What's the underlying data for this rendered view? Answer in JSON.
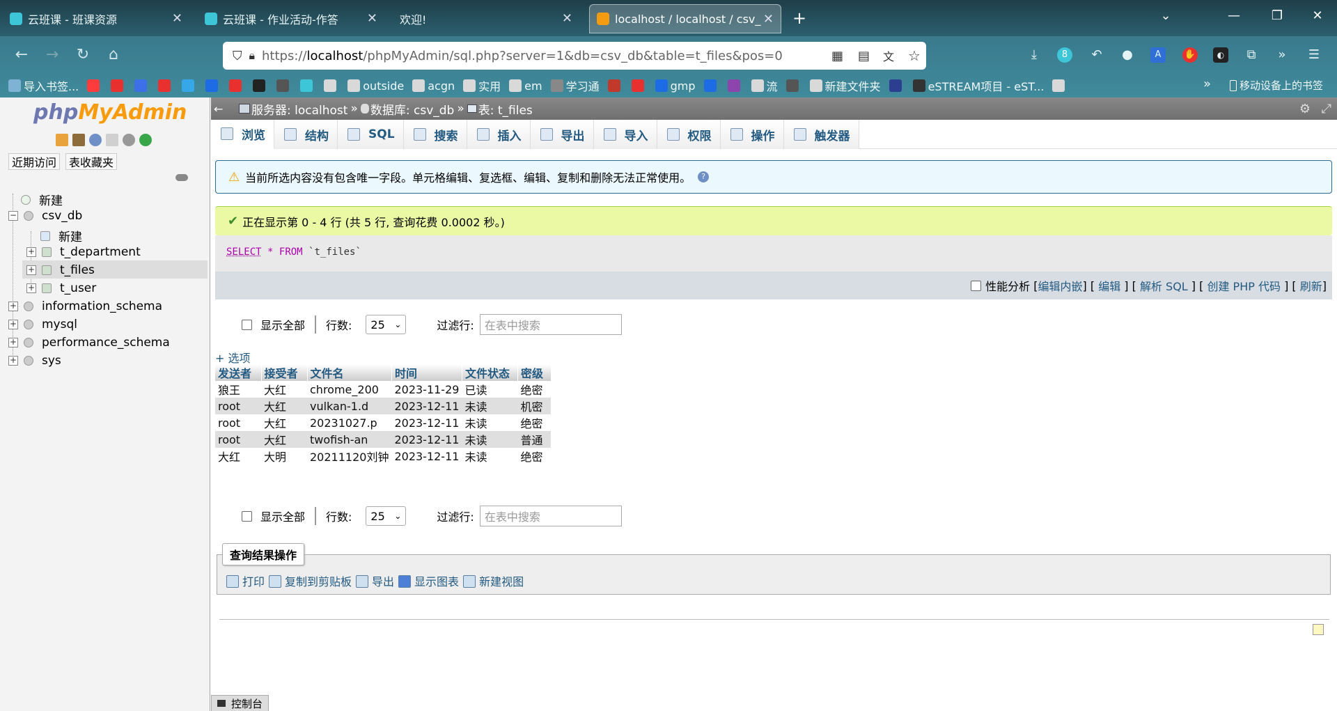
{
  "browser": {
    "tabs": [
      {
        "label": "云班课 - 班课资源"
      },
      {
        "label": "云班课 - 作业活动-作答"
      },
      {
        "label": "欢迎!"
      },
      {
        "label": "localhost / localhost / csv_db"
      }
    ],
    "new_tab": "+",
    "url_prefix": "https://",
    "url_host": "localhost",
    "url_path": "/phpMyAdmin/sql.php?server=1&db=csv_db&table=t_files&pos=0",
    "extension_badge": "8",
    "bookmarks": [
      {
        "label": "导入书签...",
        "color": "#7fb3d5"
      },
      {
        "label": "",
        "color": "#ff3b3b"
      },
      {
        "label": "",
        "color": "#e8312f"
      },
      {
        "label": "",
        "color": "#3d6fe8"
      },
      {
        "label": "",
        "color": "#e8312f"
      },
      {
        "label": "",
        "color": "#36a7e8"
      },
      {
        "label": "",
        "color": "#1e6be6"
      },
      {
        "label": "",
        "color": "#e8312f"
      },
      {
        "label": "",
        "color": "#222222"
      },
      {
        "label": "",
        "color": "#555555"
      },
      {
        "label": "",
        "color": "#3cc6d8"
      },
      {
        "label": "",
        "color": "#d9d9d9"
      },
      {
        "label": "outside",
        "color": "#d9d9d9"
      },
      {
        "label": "acgn",
        "color": "#d9d9d9"
      },
      {
        "label": "实用",
        "color": "#d9d9d9"
      },
      {
        "label": "em",
        "color": "#d9d9d9"
      },
      {
        "label": "学习通",
        "color": "#888888"
      },
      {
        "label": "",
        "color": "#c0392b"
      },
      {
        "label": "",
        "color": "#e8312f"
      },
      {
        "label": "gmp",
        "color": "#1e6be6"
      },
      {
        "label": "",
        "color": "#1e6be6"
      },
      {
        "label": "",
        "color": "#8e44ad"
      },
      {
        "label": "流",
        "color": "#d9d9d9"
      },
      {
        "label": "",
        "color": "#555555"
      },
      {
        "label": "新建文件夹",
        "color": "#d9d9d9"
      },
      {
        "label": "",
        "color": "#2c3e8f"
      },
      {
        "label": "eSTREAM项目 - eST...",
        "color": "#333333"
      },
      {
        "label": "",
        "color": "#d9d9d9"
      }
    ],
    "bookmarks_more": "»",
    "mobile_bookmarks": "移动设备上的书签"
  },
  "sidebar": {
    "logo_php": "php",
    "logo_myadmin": "MyAdmin",
    "recent_button": "近期访问",
    "favorites_button": "表收藏夹",
    "tree": [
      {
        "label": "新建",
        "level": 0
      },
      {
        "label": "csv_db",
        "level": 0
      },
      {
        "label": "新建",
        "level": 1
      },
      {
        "label": "t_department",
        "level": 1
      },
      {
        "label": "t_files",
        "level": 1
      },
      {
        "label": "t_user",
        "level": 1
      },
      {
        "label": "information_schema",
        "level": 0
      },
      {
        "label": "mysql",
        "level": 0
      },
      {
        "label": "performance_schema",
        "level": 0
      },
      {
        "label": "sys",
        "level": 0
      }
    ]
  },
  "breadcrumb": {
    "server": "服务器: localhost",
    "sep": "»",
    "database": "数据库: csv_db",
    "table": "表: t_files"
  },
  "main_tabs": [
    "浏览",
    "结构",
    "SQL",
    "搜索",
    "插入",
    "导出",
    "导入",
    "权限",
    "操作",
    "触发器"
  ],
  "warning": "当前所选内容没有包含唯一字段。单元格编辑、复选框、编辑、复制和删除无法正常使用。",
  "success": "正在显示第 0 - 4 行 (共 5 行, 查询花费 0.0002 秒。)",
  "sql": {
    "kw1": "SELECT",
    "star": "*",
    "kw2": "FROM",
    "table": "`t_files`"
  },
  "sql_links": {
    "profiling": "性能分析",
    "edit_inline": "编辑内嵌",
    "edit": "编辑",
    "explain": "解析 SQL",
    "create_php": "创建 PHP 代码",
    "refresh": "刷新"
  },
  "nav": {
    "show_all": "显示全部",
    "rows_label": "行数:",
    "rows_value": "25",
    "filter_label": "过滤行:",
    "filter_placeholder": "在表中搜索"
  },
  "options_link": "+ 选项",
  "table": {
    "headers": [
      "发送者",
      "接受者",
      "文件名",
      "时间",
      "文件状态",
      "密级"
    ],
    "rows": [
      [
        "狼王",
        "大红",
        "chrome_200",
        "2023-11-29",
        "已读",
        "绝密"
      ],
      [
        "root",
        "大红",
        "vulkan-1.d",
        "2023-12-11",
        "未读",
        "机密"
      ],
      [
        "root",
        "大红",
        "20231027.p",
        "2023-12-11",
        "未读",
        "绝密"
      ],
      [
        "root",
        "大红",
        "twofish-an",
        "2023-12-11",
        "未读",
        "普通"
      ],
      [
        "大红",
        "大明",
        "20211120刘钟",
        "2023-12-11",
        "未读",
        "绝密"
      ]
    ]
  },
  "query_ops": {
    "legend": "查询结果操作",
    "print": "打印",
    "copy": "复制到剪贴板",
    "export": "导出",
    "chart": "显示图表",
    "create_view": "新建视图"
  },
  "console": "控制台"
}
